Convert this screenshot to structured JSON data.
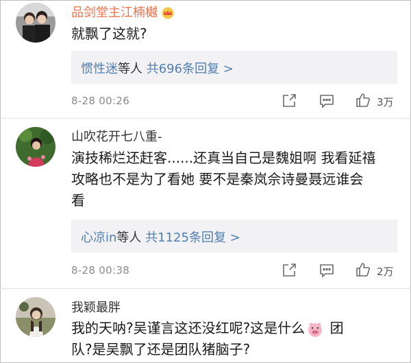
{
  "comments": [
    {
      "user": "品剑堂主江楠樾",
      "text": "就飘了这就?",
      "reply_user": "惯性迷",
      "reply_mid": "等人 ",
      "reply_count": "共696条回复 >",
      "time": "8-28 00:26",
      "likes": "3万"
    },
    {
      "user": "山吹花开七八重-",
      "text_lines": [
        "演技稀烂还赶客......还真当自己是魏姐啊 我看延禧",
        "攻略也不是为了看她 要不是秦岚佘诗曼聂远谁会",
        "看"
      ],
      "reply_user": "心凉in",
      "reply_mid": "等人 ",
      "reply_count": "共1125条回复 >",
      "time": "8-28 00:38",
      "likes": "2万"
    },
    {
      "user": "我颖最胖",
      "text_line1_a": "我的天呐?吴谨言这还没红呢?这是什么",
      "text_line1_b": " 团",
      "text_line2": "队?是吴飘了还是团队猪脑子?"
    }
  ],
  "icons": {
    "crown": "crown-badge-icon",
    "share": "share-icon",
    "comment": "comment-icon",
    "like": "like-icon",
    "emoji": "pig-face-emoji"
  },
  "colors": {
    "vip_name": "#eb7350",
    "link": "#507daf",
    "reply_bg": "#f2f2f5",
    "meta": "#8a8a8a"
  }
}
